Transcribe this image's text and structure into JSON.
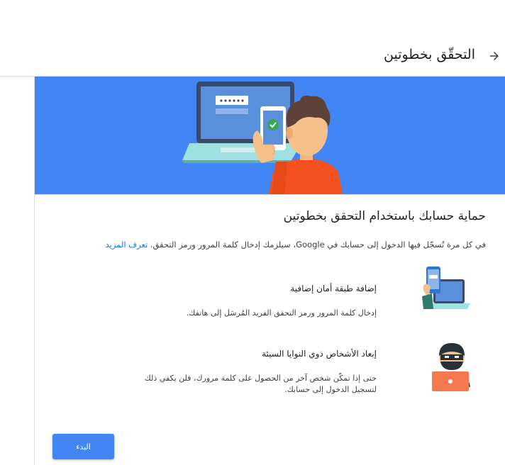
{
  "header": {
    "title": "التحقّق بخطوتين",
    "back_icon": "arrow-forward-icon"
  },
  "banner": {
    "color": "#4285f4",
    "illustration": "laptop-phone-person-illustration"
  },
  "main": {
    "title": "حماية حسابك باستخدام التحقق بخطوتين",
    "intro_text": "في كل مرة تُسجّل فيها الدخول إلى حسابك في Google، سيلزمك إدخال كلمة المرور ورمز التحقق.",
    "learn_more_label": "تعرف المزيد",
    "features": [
      {
        "icon": "phone-laptop-security-icon",
        "title": "إضافة طبقة أمان إضافية",
        "description": "إدخال كلمة المرور ورمز التحقق الفريد المُرسَل إلى هاتفك."
      },
      {
        "icon": "masked-person-laptop-icon",
        "title": "إبعاد الأشخاص ذوي النوايا السيئة",
        "description": "حتى إذا تمكّن شخص آخر من الحصول على كلمة مرورك، فلن يكفي ذلك لتسجيل الدخول إلى حسابك."
      }
    ],
    "start_button_label": "البدء"
  },
  "colors": {
    "accent": "#4285f4",
    "link": "#1a73e8",
    "text": "#202124"
  }
}
